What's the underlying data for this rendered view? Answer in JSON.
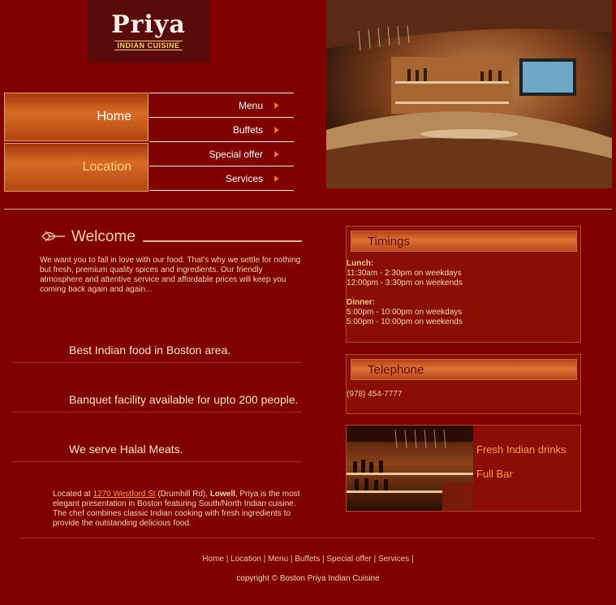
{
  "logo": {
    "name": "Priya",
    "subtitle": "INDIAN CUISINE"
  },
  "nav": {
    "home": "Home",
    "location": "Location",
    "menu": [
      "Menu",
      "Buffets",
      "Special offer",
      "Services"
    ]
  },
  "welcome": {
    "title": "Welcome",
    "text": "We want you to fall in love with our food. That's why we settle for nothing but fresh, premium quality spices and ingredients. Our friendly atmosphere and attentive service and affordable prices will keep you coming back again and again..."
  },
  "features": [
    "Best Indian food in Boston area.",
    "Banquet facility available for upto 200 people.",
    "We serve Halal Meats."
  ],
  "located": {
    "prefix": "Located at ",
    "address_link": "1270 Westford St",
    "mid": " (Drumhill Rd), ",
    "city": "Lowell",
    "rest": ", Priya is the most elegant presentation in Boston featuring South/North Indian cuisine. The chef combines classic Indian cooking with fresh ingredients to provide the outstanding delicious food."
  },
  "timings": {
    "title": "Timings",
    "lunch_label": "Lunch:",
    "lunch": [
      "11:30am - 2:30pm on weekdays",
      "12:00pm - 3:30pm on weekends"
    ],
    "dinner_label": "Dinner:",
    "dinner": [
      "5:00pm - 10:00pm on weekdays",
      "5:00pm - 10:00pm on weekends"
    ]
  },
  "telephone": {
    "title": "Telephone",
    "number": "(978) 454-7777"
  },
  "drinks": {
    "line1": "Fresh Indian drinks",
    "line2": "Full Bar"
  },
  "footer": {
    "links": [
      "Home",
      "Location",
      "Menu",
      "Buffets",
      "Special offer",
      "Services"
    ],
    "copyright": "copyright © Boston Priya Indian Cuisine"
  },
  "colors": {
    "background": "#800000",
    "accent": "#d86c24",
    "link": "#ff9a4a"
  },
  "icons": [
    "menu-arrow-icon",
    "ornament-icon"
  ]
}
